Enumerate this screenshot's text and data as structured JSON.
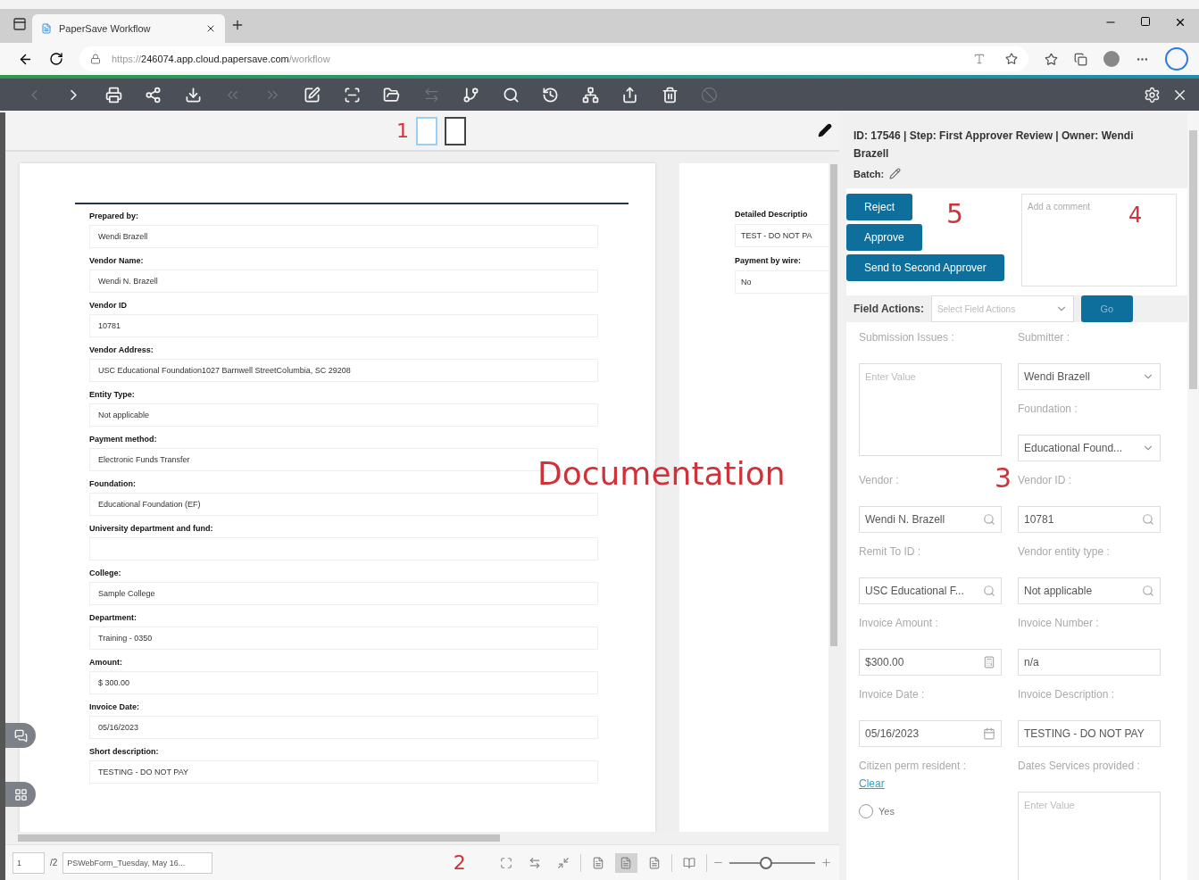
{
  "browser": {
    "tab_title": "PaperSave Workflow",
    "url": {
      "scheme": "https://",
      "host": "246074.app.cloud.papersave.com",
      "path": "/workflow"
    }
  },
  "toolbar": {
    "tools": [
      {
        "kind": "prev",
        "disabled": true
      },
      {
        "kind": "next",
        "disabled": false
      },
      {
        "kind": "print",
        "disabled": false
      },
      {
        "kind": "share",
        "disabled": false
      },
      {
        "kind": "download",
        "disabled": false
      },
      {
        "kind": "first",
        "disabled": true
      },
      {
        "kind": "last",
        "disabled": true
      },
      {
        "kind": "edit",
        "disabled": false
      },
      {
        "kind": "scan",
        "disabled": false
      },
      {
        "kind": "folder",
        "disabled": false
      },
      {
        "kind": "swap",
        "disabled": true
      },
      {
        "kind": "branch",
        "disabled": false
      },
      {
        "kind": "search",
        "disabled": false
      },
      {
        "kind": "history",
        "disabled": false
      },
      {
        "kind": "workflow",
        "disabled": false
      },
      {
        "kind": "export",
        "disabled": false
      },
      {
        "kind": "delete",
        "disabled": false
      },
      {
        "kind": "block",
        "disabled": true
      }
    ],
    "right_tools": [
      {
        "kind": "settings"
      },
      {
        "kind": "close"
      }
    ]
  },
  "viewer": {
    "page_marker": "1",
    "thumbnails": [
      {
        "selected": true
      },
      {
        "selected": false
      }
    ],
    "pages": [
      {
        "fields": [
          {
            "label": "Prepared by:",
            "value": "Wendi Brazell"
          },
          {
            "label": "Vendor Name:",
            "value": "Wendi N. Brazell"
          },
          {
            "label": "Vendor ID",
            "value": "10781"
          },
          {
            "label": "Vendor Address:",
            "value": "USC Educational Foundation1027 Barnwell StreetColumbia, SC 29208"
          },
          {
            "label": "Entity Type:",
            "value": "Not applicable"
          },
          {
            "label": "Payment method:",
            "value": "Electronic Funds Transfer"
          },
          {
            "label": "Foundation:",
            "value": "Educational Foundation (EF)"
          },
          {
            "label": "University department and fund:"
          },
          {
            "label": "College:",
            "value": "Sample College"
          },
          {
            "label": "Department:",
            "value": "Training - 0350"
          },
          {
            "label": "Amount:",
            "value": "$ 300.00"
          },
          {
            "label": "Invoice Date:",
            "value": "05/16/2023"
          },
          {
            "label": "Short description:",
            "value": "TESTING - DO NOT PAY"
          }
        ]
      },
      {
        "fields": [
          {
            "label": "Detailed Descriptio",
            "value": "TEST - DO NOT PA"
          },
          {
            "label": "Payment by wire:",
            "value": "No"
          }
        ]
      }
    ],
    "overlay_label": "Documentation",
    "bottom_marker": "2",
    "bottom_bar": {
      "page": "1",
      "page_total": "/2",
      "file_name": "PSWebForm_Tuesday, May 16...",
      "view_tools": [
        {
          "kind": "fit",
          "selected": false
        },
        {
          "kind": "swap",
          "selected": false
        },
        {
          "kind": "shrink",
          "selected": false
        },
        {
          "kind": "page",
          "selected": false
        },
        {
          "kind": "page",
          "selected": true
        },
        {
          "kind": "page",
          "selected": false
        },
        {
          "kind": "book",
          "selected": false
        }
      ],
      "zoom": {
        "level": 0.43
      }
    }
  },
  "panel": {
    "header": "ID: 17546 | Step: First Approver Review | Owner: Wendi Brazell",
    "batch_label": "Batch:",
    "buttons": [
      "Reject",
      "Approve",
      "Send to Second Approver"
    ],
    "buttons_marker": "5",
    "comment_placeholder": "Add a comment",
    "comment_marker": "4",
    "field_actions": {
      "label": "Field Actions:",
      "placeholder": "Select Field Actions",
      "button": "Go"
    },
    "form_marker": "3",
    "form": {
      "left": [
        {
          "kind": "textarea",
          "label": "Submission Issues :",
          "placeholder": "Enter Value"
        },
        {
          "kind": "search",
          "label": "Vendor :",
          "value": "Wendi N. Brazell"
        },
        {
          "kind": "search",
          "label": "Remit To ID :",
          "value": "USC Educational F..."
        },
        {
          "kind": "number",
          "label": "Invoice Amount :",
          "value": "$300.00"
        },
        {
          "kind": "date",
          "label": "Invoice Date :",
          "value": "05/16/2023"
        },
        {
          "kind": "radio",
          "label": "Citizen perm resident :",
          "clear": "Clear",
          "options": [
            {
              "label": "Yes",
              "selected": false
            }
          ]
        }
      ],
      "right": [
        {
          "kind": "select",
          "label": "Submitter :",
          "value": "Wendi Brazell"
        },
        {
          "kind": "select",
          "label": "Foundation :",
          "value": "Educational Found..."
        },
        {
          "kind": "search",
          "label": "Vendor ID :",
          "value": "10781"
        },
        {
          "kind": "search",
          "label": "Vendor entity type :",
          "value": "Not applicable"
        },
        {
          "kind": "text",
          "label": "Invoice Number :",
          "value": "n/a"
        },
        {
          "kind": "text",
          "label": "Invoice Description :",
          "value": "TESTING - DO NOT PAY"
        },
        {
          "kind": "textarea",
          "label": "Dates Services provided :",
          "placeholder": "Enter Value"
        }
      ]
    }
  }
}
